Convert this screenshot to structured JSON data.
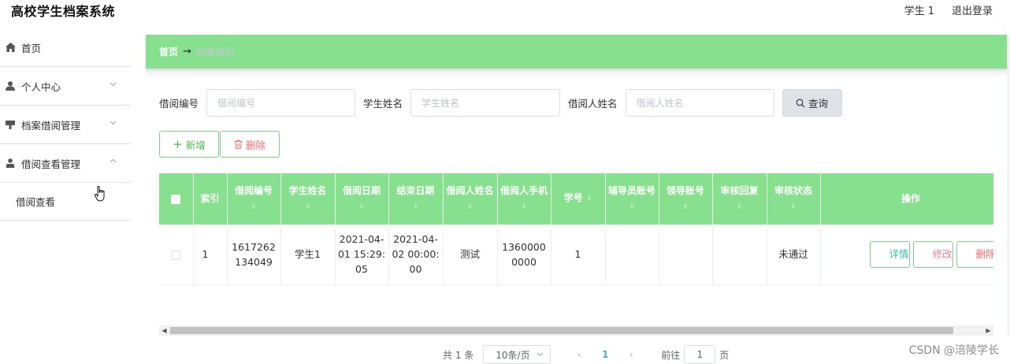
{
  "app": {
    "title": "高校学生档案系统",
    "user": "学生 1",
    "logout": "退出登录"
  },
  "sidebar": {
    "items": [
      {
        "label": "首页",
        "icon": "home-icon"
      },
      {
        "label": "个人中心",
        "icon": "user-icon"
      },
      {
        "label": "档案借阅管理",
        "icon": "stamp-icon"
      },
      {
        "label": "借阅查看管理",
        "icon": "person-icon"
      }
    ],
    "sub_items": [
      {
        "label": "借阅查看"
      }
    ]
  },
  "breadcrumb": {
    "home": "首页",
    "separator": "→",
    "current": "档案借阅"
  },
  "search": {
    "fields": [
      {
        "label": "借阅编号",
        "placeholder": "借阅编号"
      },
      {
        "label": "学生姓名",
        "placeholder": "学生姓名"
      },
      {
        "label": "借阅人姓名",
        "placeholder": "借阅人姓名"
      }
    ],
    "button": "查询"
  },
  "actions": {
    "add": "新增",
    "delete": "删除"
  },
  "table": {
    "headers": [
      "索引",
      "借阅编号",
      "学生姓名",
      "借阅日期",
      "结束日期",
      "借阅人姓名",
      "借阅人手机",
      "学号",
      "辅导员账号",
      "领导账号",
      "审核回复",
      "审核状态",
      "操作"
    ],
    "rows": [
      {
        "index": "1",
        "borrow_no": "1617262134049",
        "student_name": "学生1",
        "borrow_date": "2021-04-01 15:29:05",
        "end_date": "2021-04-02 00:00:00",
        "borrower_name": "测试",
        "borrower_phone": "13600000000",
        "student_no": "1",
        "counselor_account": "",
        "leader_account": "",
        "review_reply": "",
        "review_status": "未通过"
      }
    ],
    "row_actions": {
      "detail": "详情",
      "edit": "修改",
      "delete": "删除"
    }
  },
  "pagination": {
    "total": "共 1 条",
    "page_size": "10条/页",
    "current_page": "1",
    "goto_label": "前往",
    "goto_value": "1",
    "page_unit": "页"
  },
  "watermark": "CSDN @涪陵学长",
  "colors": {
    "accent_green": "#86e08e",
    "danger": "#f56c6c",
    "link_blue": "#4ea6d9"
  }
}
